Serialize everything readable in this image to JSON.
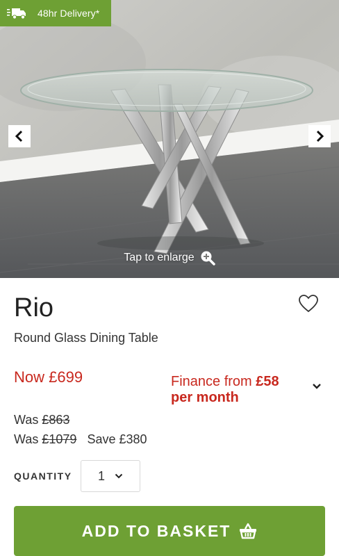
{
  "delivery_badge": {
    "label": "48hr Delivery*",
    "icon": "truck-icon",
    "color": "#6ea034"
  },
  "gallery": {
    "prev_icon": "chevron-left-icon",
    "next_icon": "chevron-right-icon",
    "enlarge_label": "Tap to enlarge",
    "enlarge_icon": "zoom-in-icon"
  },
  "product": {
    "name": "Rio",
    "subtitle": "Round Glass Dining Table",
    "wishlist_icon": "heart-icon"
  },
  "pricing": {
    "now_label": "Now £699",
    "finance_prefix": "Finance from",
    "finance_amount": "£58",
    "finance_suffix": "per month",
    "was_label_1": "Was",
    "was_price_1": "£863",
    "was_label_2": "Was",
    "was_price_2": "£1079",
    "save_label": "Save £380",
    "accent_color": "#c8281e"
  },
  "quantity": {
    "label": "QUANTITY",
    "value": "1"
  },
  "basket_button": {
    "label": "ADD TO BASKET",
    "icon": "basket-icon",
    "color": "#6ea034"
  }
}
